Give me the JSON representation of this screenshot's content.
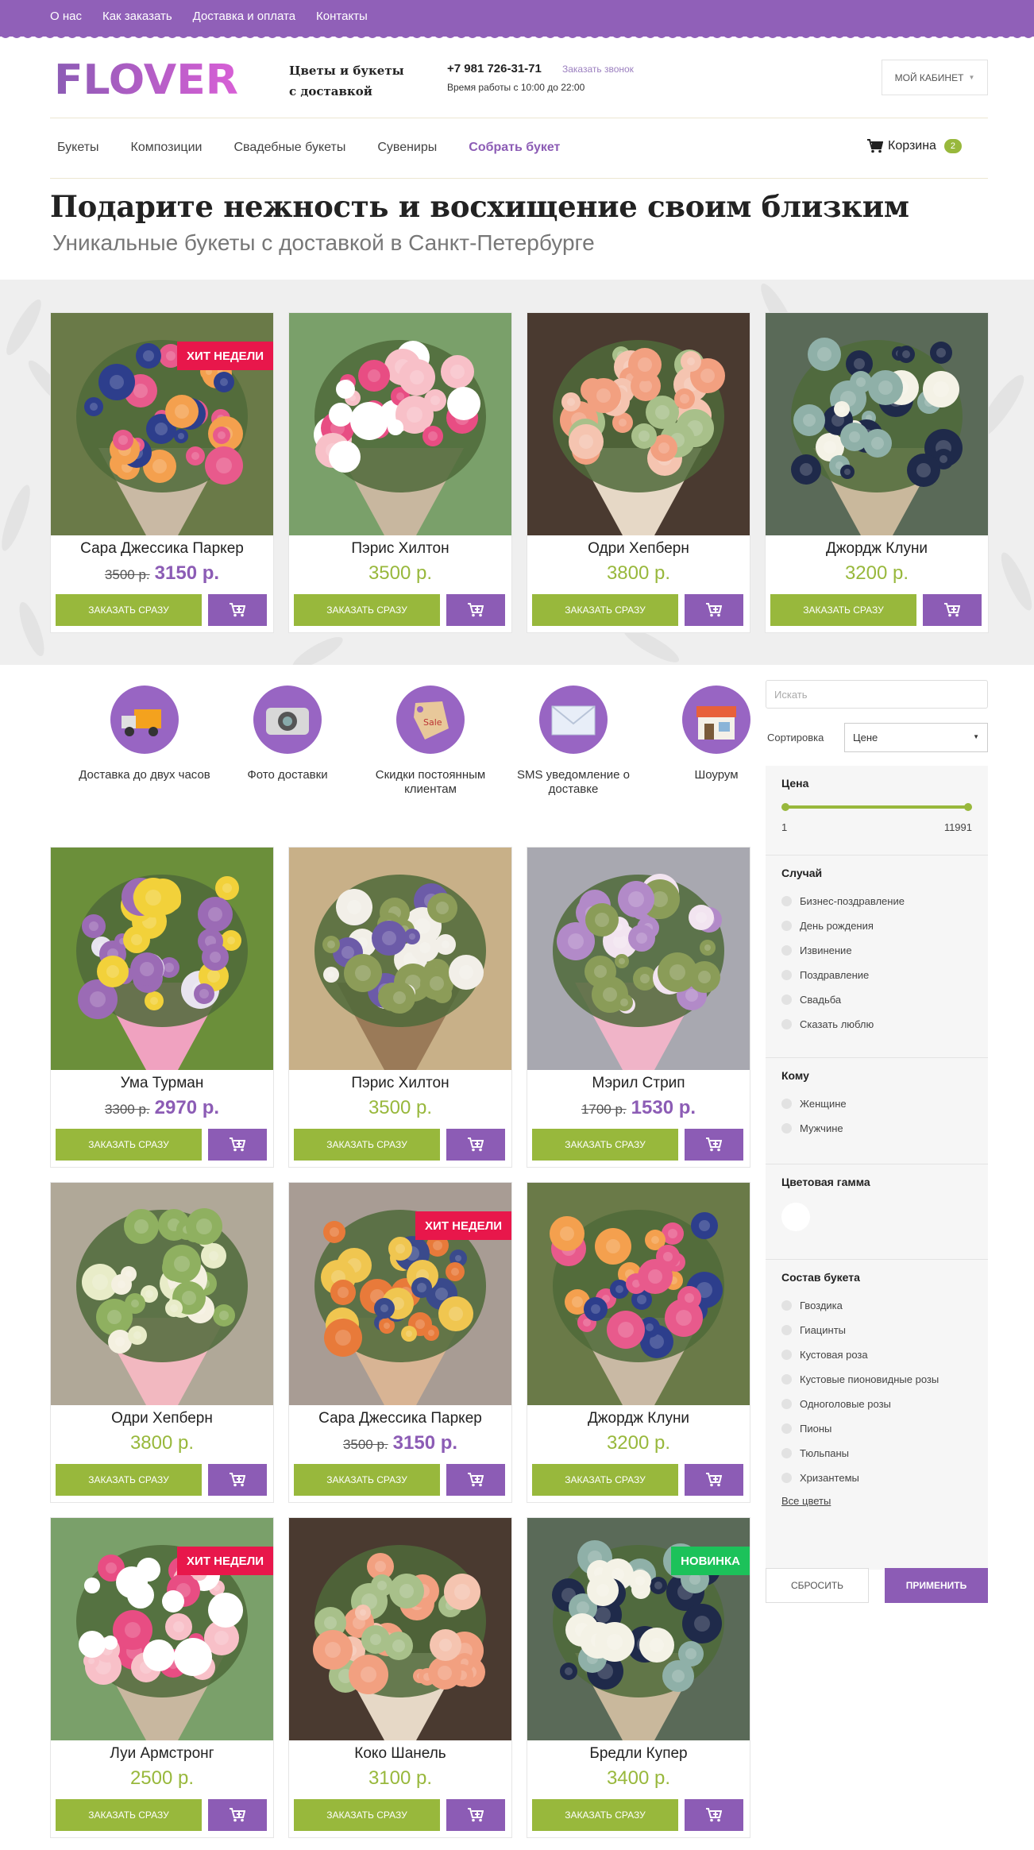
{
  "topnav": [
    "О нас",
    "Как заказать",
    "Доставка и оплата",
    "Контакты"
  ],
  "brand": {
    "logo_text": "FLOVER",
    "tagline_1": "Цветы и букеты",
    "tagline_2": "с доставкой"
  },
  "contact": {
    "phone": "+7 981 726-31-71",
    "callback": "Заказать звонок",
    "hours": "Время работы с 10:00 до 22:00"
  },
  "cabinet": "МОЙ КАБИНЕТ",
  "mainnav": [
    "Букеты",
    "Композиции",
    "Свадебные букеты",
    "Сувениры",
    "Собрать букет"
  ],
  "cart": {
    "label": "Корзина",
    "count": "2"
  },
  "hero": {
    "title": "Подарите нежность и восхищение своим близким",
    "subtitle": "Уникальные букеты с доставкой в Санкт-Петербурге"
  },
  "labels": {
    "order": "ЗАКАЗАТЬ СРАЗУ",
    "hit": "ХИТ НЕДЕЛИ",
    "new": "НОВИНКА"
  },
  "featured": [
    {
      "name": "Сара Джессика Паркер",
      "old": "3500 р.",
      "price": "3150 р.",
      "badge": "hit"
    },
    {
      "name": "Пэрис Хилтон",
      "old": "",
      "price": "3500 р.",
      "badge": ""
    },
    {
      "name": "Одри Хепберн",
      "old": "",
      "price": "3800 р.",
      "badge": ""
    },
    {
      "name": "Джордж Клуни",
      "old": "",
      "price": "3200 р.",
      "badge": ""
    }
  ],
  "features": [
    {
      "label": "Доставка до двух часов",
      "icon": "truck-icon"
    },
    {
      "label": "Фото доставки",
      "icon": "camera-icon"
    },
    {
      "label": "Скидки постоянным клиентам",
      "icon": "sale-tag-icon"
    },
    {
      "label": "SMS уведомление о доставке",
      "icon": "envelope-icon"
    },
    {
      "label": "Шоурум",
      "icon": "storefront-icon"
    }
  ],
  "catalog": [
    {
      "name": "Ума Турман",
      "old": "3300 р.",
      "price": "2970 р.",
      "badge": ""
    },
    {
      "name": "Пэрис Хилтон",
      "old": "",
      "price": "3500 р.",
      "badge": ""
    },
    {
      "name": "Мэрил Стрип",
      "old": "1700 р.",
      "price": "1530 р.",
      "badge": ""
    },
    {
      "name": "Одри Хепберн",
      "old": "",
      "price": "3800 р.",
      "badge": ""
    },
    {
      "name": "Сара Джессика Паркер",
      "old": "3500 р.",
      "price": "3150 р.",
      "badge": "hit"
    },
    {
      "name": "Джордж Клуни",
      "old": "",
      "price": "3200 р.",
      "badge": ""
    },
    {
      "name": "Луи Армстронг",
      "old": "",
      "price": "2500 р.",
      "badge": "hit"
    },
    {
      "name": "Коко Шанель",
      "old": "",
      "price": "3100 р.",
      "badge": ""
    },
    {
      "name": "Бредли Купер",
      "old": "",
      "price": "3400 р.",
      "badge": "new"
    }
  ],
  "sidebar": {
    "search_placeholder": "Искать",
    "sort_label": "Сортировка",
    "sort_value": "Цене",
    "price": {
      "title": "Цена",
      "min": "1",
      "max": "11991"
    },
    "occasion": {
      "title": "Случай",
      "items": [
        "Бизнес-поздравление",
        "День рождения",
        "Извинение",
        "Поздравление",
        "Свадьба",
        "Сказать люблю"
      ]
    },
    "recipient": {
      "title": "Кому",
      "items": [
        "Женщине",
        "Мужчине"
      ]
    },
    "color": {
      "title": "Цветовая гамма"
    },
    "composition": {
      "title": "Состав букета",
      "items": [
        "Гвоздика",
        "Гиацинты",
        "Кустовая роза",
        "Кустовые пионовидные розы",
        "Одноголовые розы",
        "Пионы",
        "Тюльпаны",
        "Хризантемы"
      ],
      "all": "Все цветы"
    },
    "reset": "СБРОСИТЬ",
    "apply": "ПРИМЕНИТЬ"
  },
  "colors": {
    "purple": "#8c5cb5",
    "green": "#98b83c",
    "hit": "#e8174b",
    "new": "#1cc25a"
  }
}
